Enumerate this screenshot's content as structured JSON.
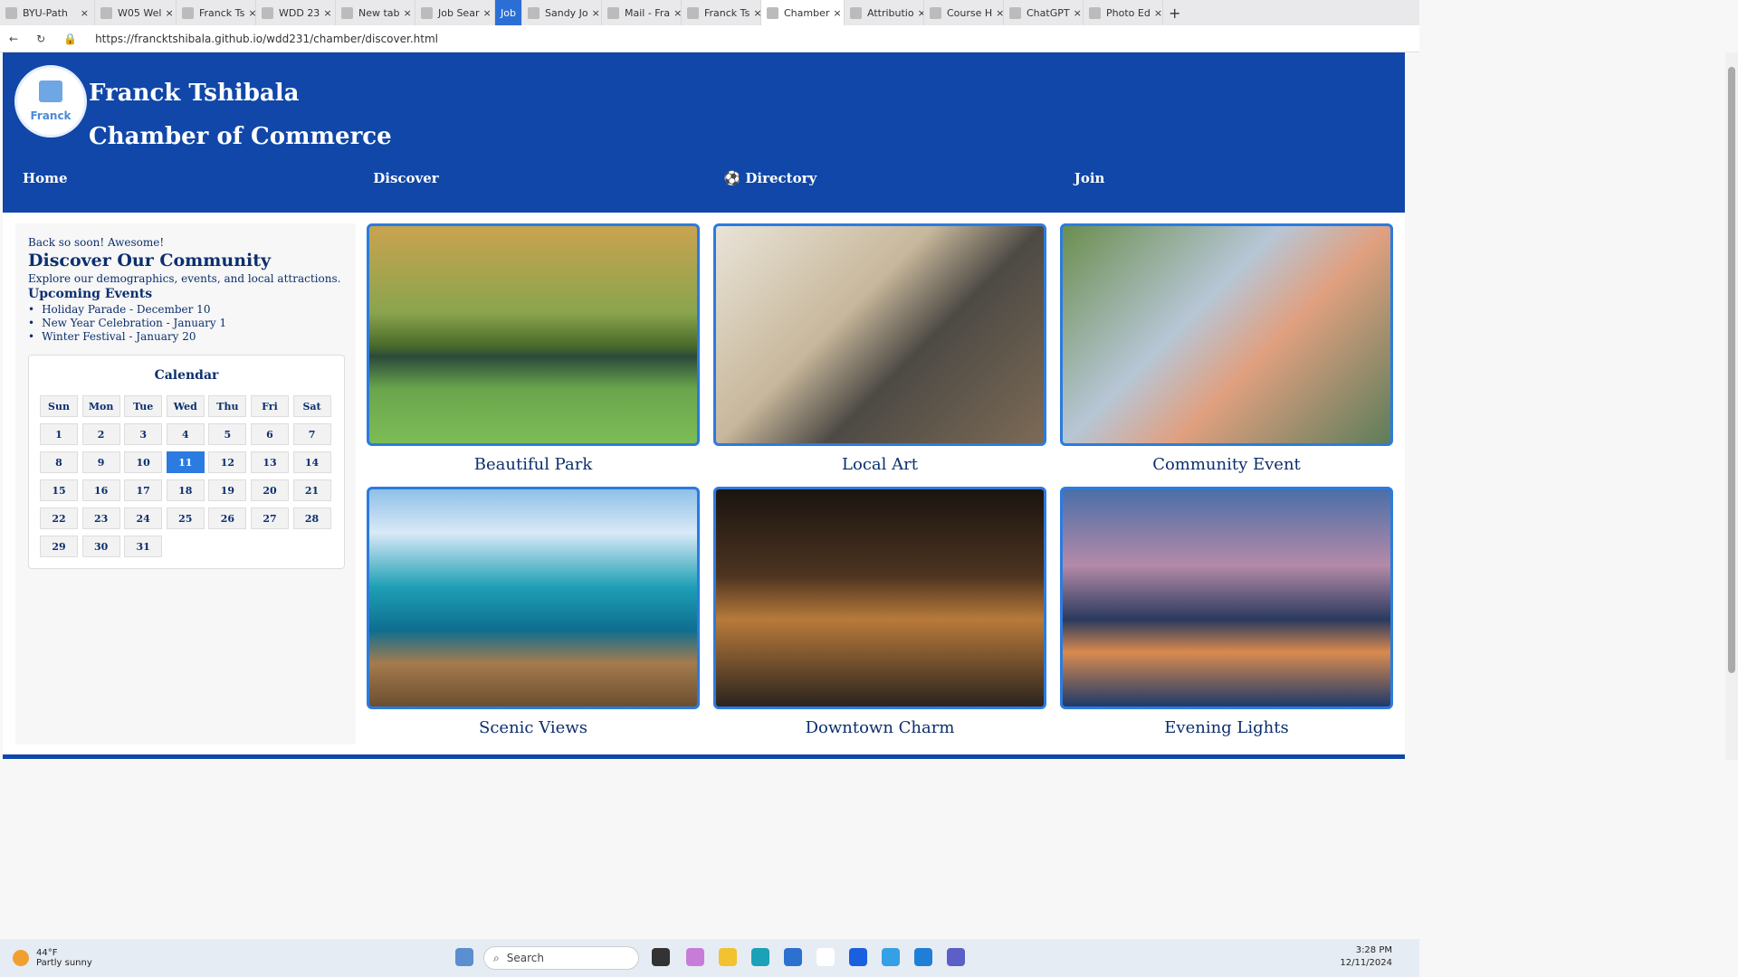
{
  "browser": {
    "tabs": [
      {
        "label": "BYU-Path"
      },
      {
        "label": "W05 Wel"
      },
      {
        "label": "Franck Ts"
      },
      {
        "label": "WDD 23"
      },
      {
        "label": "New tab"
      },
      {
        "label": "Job Sear"
      },
      {
        "label": "Job"
      },
      {
        "label": "Sandy Jo"
      },
      {
        "label": "Mail - Fra"
      },
      {
        "label": "Franck Ts"
      },
      {
        "label": "Chamber"
      },
      {
        "label": "Attributio"
      },
      {
        "label": "Course H"
      },
      {
        "label": "ChatGPT"
      },
      {
        "label": "Photo Ed"
      }
    ],
    "url": "https://francktshibala.github.io/wdd231/chamber/discover.html"
  },
  "site": {
    "logo_text": "Franck",
    "title_line1": "Franck Tshibala",
    "title_line2": "Chamber of Commerce",
    "nav": {
      "home": "Home",
      "discover": "Discover",
      "directory": "⚽ Directory",
      "join": "Join"
    }
  },
  "sidebar": {
    "welcome": "Back so soon! Awesome!",
    "heading": "Discover Our Community",
    "intro": "Explore our demographics, events, and local attractions.",
    "events_heading": "Upcoming Events",
    "events": [
      "Holiday Parade - December 10",
      "New Year Celebration - January 1",
      "Winter Festival - January 20"
    ],
    "calendar": {
      "title": "Calendar",
      "days": [
        "Sun",
        "Mon",
        "Tue",
        "Wed",
        "Thu",
        "Fri",
        "Sat"
      ],
      "dates": [
        "1",
        "2",
        "3",
        "4",
        "5",
        "6",
        "7",
        "8",
        "9",
        "10",
        "11",
        "12",
        "13",
        "14",
        "15",
        "16",
        "17",
        "18",
        "19",
        "20",
        "21",
        "22",
        "23",
        "24",
        "25",
        "26",
        "27",
        "28",
        "29",
        "30",
        "31"
      ],
      "today": "11"
    }
  },
  "gallery": [
    {
      "caption": "Beautiful Park"
    },
    {
      "caption": "Local Art"
    },
    {
      "caption": "Community Event"
    },
    {
      "caption": "Scenic Views"
    },
    {
      "caption": "Downtown Charm"
    },
    {
      "caption": "Evening Lights"
    }
  ],
  "taskbar": {
    "weather_temp": "44°F",
    "weather_desc": "Partly sunny",
    "search_placeholder": "Search",
    "time": "3:28 PM",
    "date": "12/11/2024"
  }
}
